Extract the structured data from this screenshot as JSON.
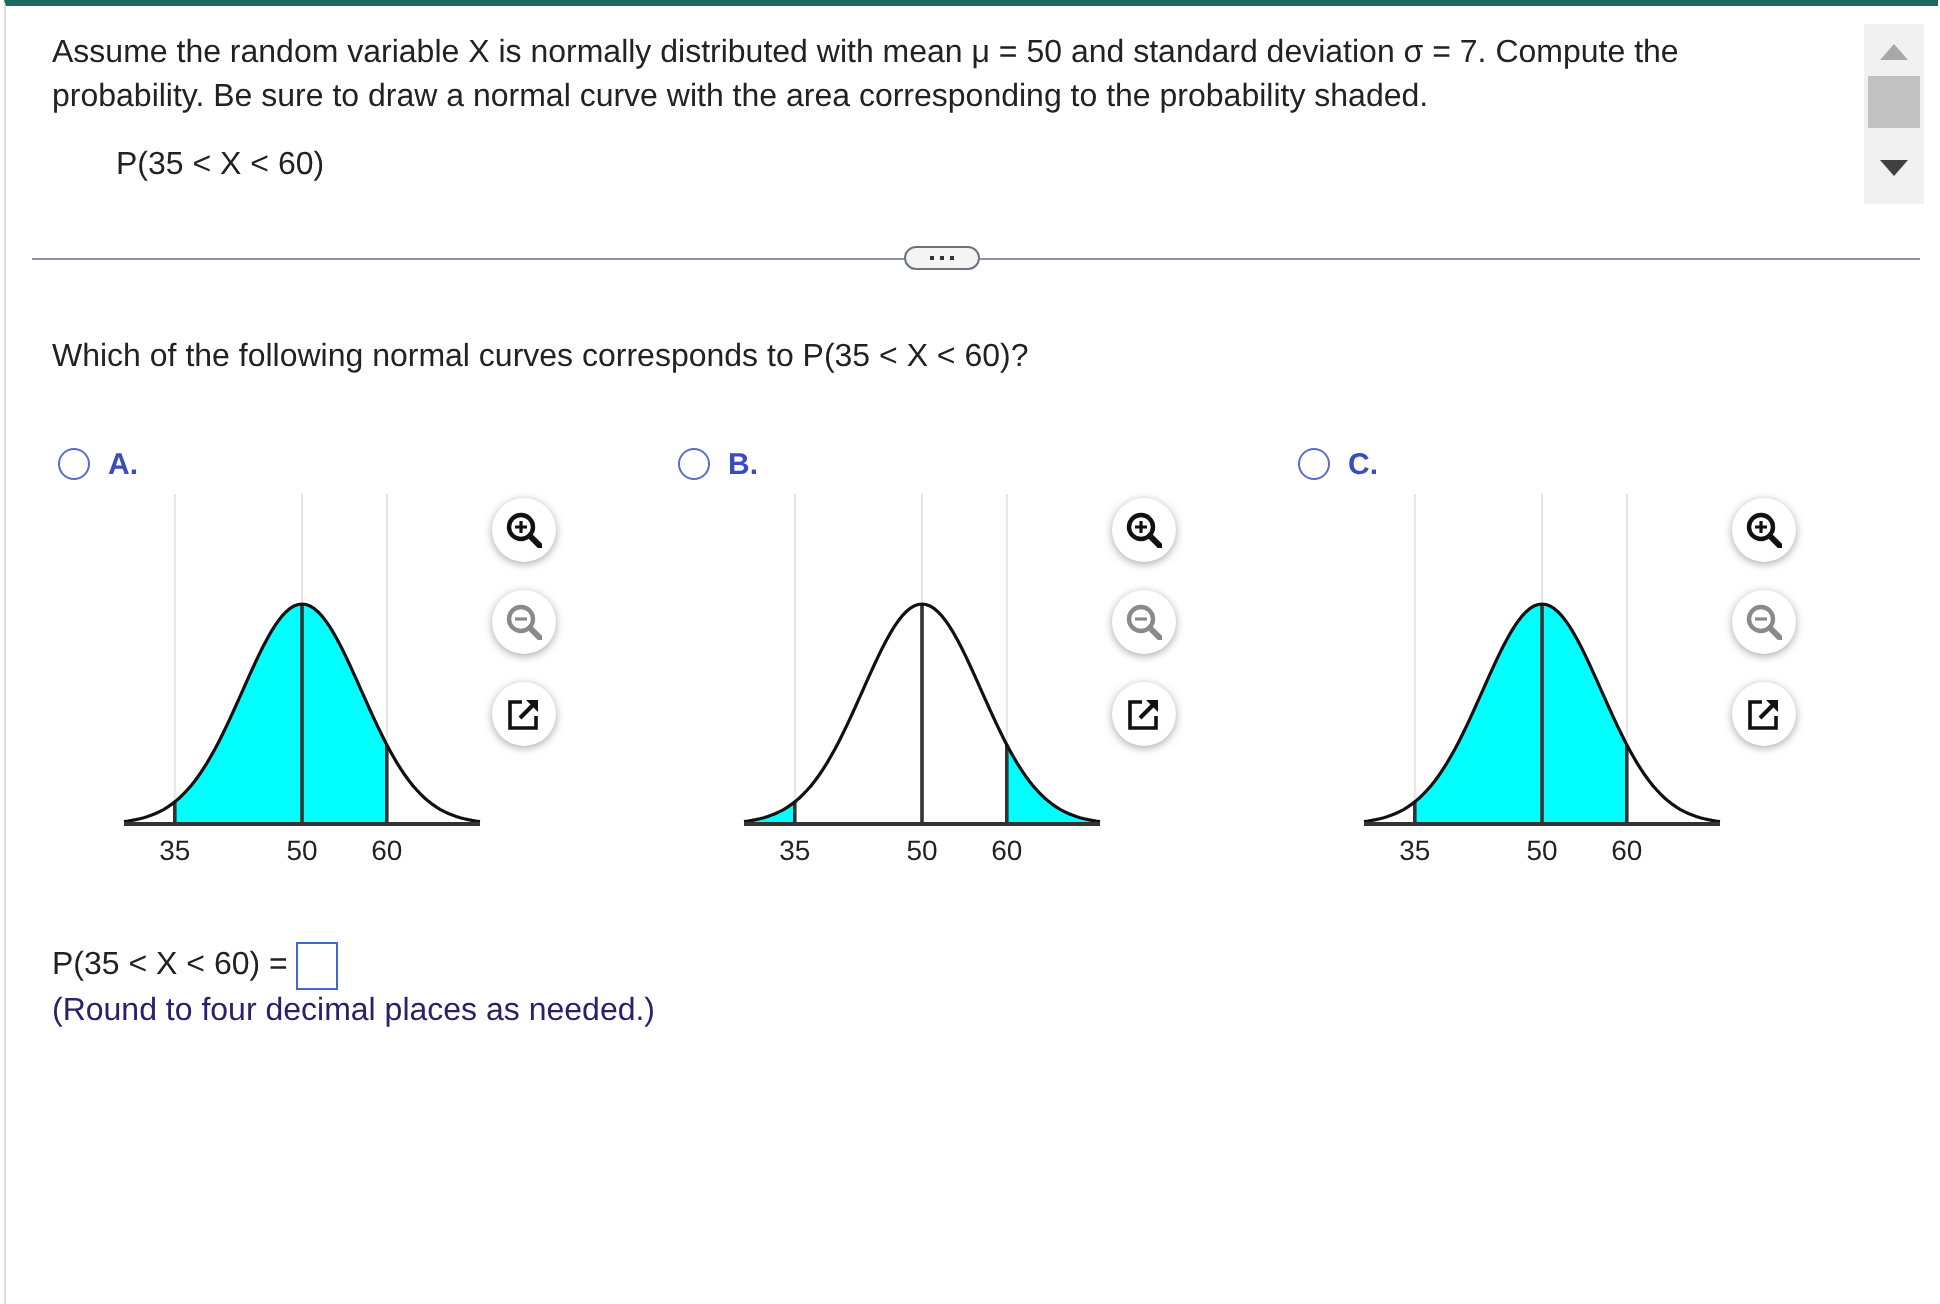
{
  "question": {
    "text": "Assume the random variable X is normally distributed with mean μ = 50 and standard deviation σ = 7. Compute the probability. Be sure to draw a normal curve with the area corresponding to the probability shaded.",
    "expression": "P(35 < X < 60)"
  },
  "prompt": "Which of the following normal curves corresponds to P(35 < X < 60)?",
  "options": [
    {
      "label": "A.",
      "selected": false,
      "tools": [
        {
          "kind": "zoom_in",
          "disabled": false
        },
        {
          "kind": "zoom_out",
          "disabled": true
        },
        {
          "kind": "popout",
          "disabled": false
        }
      ],
      "graph": {
        "ticks": [
          "35",
          "50",
          "60"
        ],
        "regions": [
          {
            "shaded": false
          },
          {
            "shaded": true
          },
          {
            "shaded": true
          },
          {
            "shaded": false
          }
        ]
      }
    },
    {
      "label": "B.",
      "selected": false,
      "tools": [
        {
          "kind": "zoom_in",
          "disabled": false
        },
        {
          "kind": "zoom_out",
          "disabled": true
        },
        {
          "kind": "popout",
          "disabled": false
        }
      ],
      "graph": {
        "ticks": [
          "35",
          "50",
          "60"
        ],
        "regions": [
          {
            "shaded": true
          },
          {
            "shaded": false
          },
          {
            "shaded": false
          },
          {
            "shaded": true
          }
        ]
      }
    },
    {
      "label": "C.",
      "selected": false,
      "tools": [
        {
          "kind": "zoom_in",
          "disabled": false
        },
        {
          "kind": "zoom_out",
          "disabled": true
        },
        {
          "kind": "popout",
          "disabled": false
        }
      ],
      "graph": {
        "ticks": [
          "35",
          "50",
          "60"
        ],
        "regions": [
          {
            "shaded": false
          },
          {
            "shaded": true
          },
          {
            "shaded": true
          },
          {
            "shaded": false
          }
        ]
      }
    }
  ],
  "answer": {
    "label": "P(35 < X < 60) =",
    "note": "(Round to four decimal places as needed.)"
  }
}
